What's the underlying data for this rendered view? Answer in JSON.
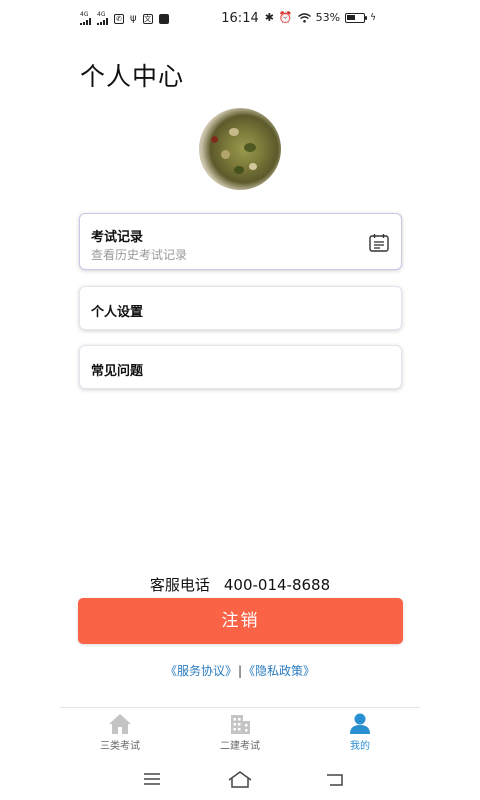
{
  "status_bar": {
    "signal1": "4G",
    "signal2": "4G",
    "time": "16:14",
    "battery": "53%",
    "battery_level": 0.53
  },
  "header": {
    "title": "个人中心"
  },
  "menu": {
    "exam_records": {
      "title": "考试记录",
      "subtitle": "查看历史考试记录"
    },
    "settings": {
      "title": "个人设置"
    },
    "faq": {
      "title": "常见问题"
    }
  },
  "support": {
    "label": "客服电话",
    "phone": "400-014-8688"
  },
  "logout": {
    "label": "注销"
  },
  "agreements": {
    "service": "《服务协议》",
    "separator": "|",
    "privacy": "《隐私政策》"
  },
  "tabs": [
    {
      "label": "三类考试",
      "icon": "home-icon"
    },
    {
      "label": "二建考试",
      "icon": "building-icon"
    },
    {
      "label": "我的",
      "icon": "person-icon"
    }
  ],
  "colors": {
    "accent": "#fb6347",
    "link": "#2a7bbf",
    "active_tab": "#2a8fd0",
    "inactive_tab": "#c4c4c4"
  }
}
